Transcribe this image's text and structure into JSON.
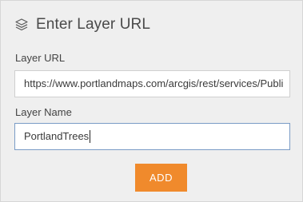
{
  "header": {
    "title": "Enter Layer URL",
    "icon": "layers-icon"
  },
  "form": {
    "layer_url": {
      "label": "Layer URL",
      "value": "https://www.portlandmaps.com/arcgis/rest/services/Publi"
    },
    "layer_name": {
      "label": "Layer Name",
      "value": "PortlandTrees"
    },
    "add_button_label": "ADD"
  },
  "colors": {
    "panel_background": "#efefef",
    "button_background": "#f08a2c",
    "focused_border": "#7a9cc6"
  }
}
